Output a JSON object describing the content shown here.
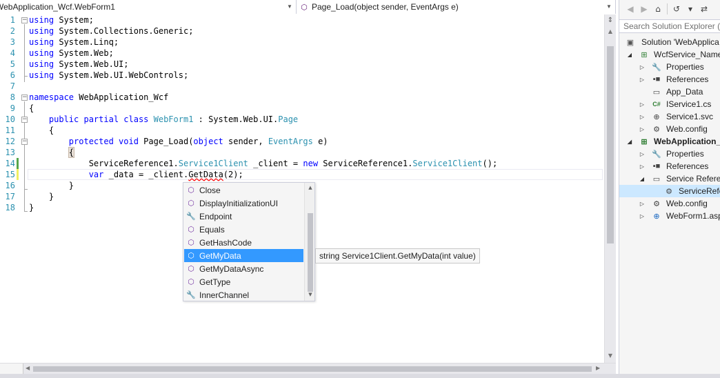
{
  "navbar": {
    "type_combo": "WebApplication_Wcf.WebForm1",
    "member_combo": "Page_Load(object sender, EventArgs e)"
  },
  "editor": {
    "line_numbers": [
      "1",
      "2",
      "3",
      "4",
      "5",
      "6",
      "7",
      "8",
      "9",
      "10",
      "11",
      "12",
      "13",
      "14",
      "15",
      "16",
      "17",
      "18"
    ],
    "lines": {
      "l1_kw": "using",
      "l1_rest": " System;",
      "l2_kw": "using",
      "l2_rest": " System.Collections.Generic;",
      "l3_kw": "using",
      "l3_rest": " System.Linq;",
      "l4_kw": "using",
      "l4_rest": " System.Web;",
      "l5_kw": "using",
      "l5_rest": " System.Web.UI;",
      "l6_kw": "using",
      "l6_rest": " System.Web.UI.WebControls;",
      "l8_kw": "namespace",
      "l8_rest": " WebApplication_Wcf",
      "l9": "{",
      "l10_kw": "    public partial class ",
      "l10_type": "WebForm1",
      "l10_mid": " : System.Web.UI.",
      "l10_type2": "Page",
      "l11": "    {",
      "l12_kw": "        protected void ",
      "l12_mid": "Page_Load(",
      "l12_kw2": "object",
      "l12_mid2": " sender, ",
      "l12_type": "EventArgs",
      "l12_end": " e)",
      "l13_indent": "        ",
      "l13_brace": "{",
      "l14_a": "            ServiceReference1.",
      "l14_type": "Service1Client",
      "l14_b": " _client = ",
      "l14_kw": "new",
      "l14_c": " ServiceReference1.",
      "l14_type2": "Service1Client",
      "l14_d": "();",
      "l15_indent": "            ",
      "l15_kw": "var",
      "l15_a": " _data = _client.",
      "l15_sq": "GetData",
      "l15_b": "(2);",
      "l16": "        }",
      "l17": "    }",
      "l18": "}"
    }
  },
  "completion": {
    "items": [
      {
        "label": "Close",
        "icon": "method-icon"
      },
      {
        "label": "DisplayInitializationUI",
        "icon": "method-icon"
      },
      {
        "label": "Endpoint",
        "icon": "property-icon"
      },
      {
        "label": "Equals",
        "icon": "method-icon"
      },
      {
        "label": "GetHashCode",
        "icon": "method-icon"
      },
      {
        "label": "GetMyData",
        "icon": "method-icon"
      },
      {
        "label": "GetMyDataAsync",
        "icon": "method-icon"
      },
      {
        "label": "GetType",
        "icon": "method-icon"
      },
      {
        "label": "InnerChannel",
        "icon": "property-icon"
      }
    ],
    "selected": "GetMyData",
    "tooltip": "string Service1Client.GetMyData(int value)"
  },
  "solution_explorer": {
    "search_placeholder": "Search Solution Explorer (C",
    "tree": [
      {
        "label": "Solution 'WebApplica",
        "icon": "solution-icon"
      },
      {
        "label": "WcfService_Name",
        "icon": "wcf-project-icon"
      },
      {
        "label": "Properties",
        "icon": "wrench-icon"
      },
      {
        "label": "References",
        "icon": "references-icon"
      },
      {
        "label": "App_Data",
        "icon": "folder-icon"
      },
      {
        "label": "IService1.cs",
        "icon": "csharp-file-icon"
      },
      {
        "label": "Service1.svc",
        "icon": "svc-file-icon"
      },
      {
        "label": "Web.config",
        "icon": "config-file-icon"
      },
      {
        "label": "WebApplication_V",
        "icon": "web-project-icon"
      },
      {
        "label": "Properties",
        "icon": "wrench-icon"
      },
      {
        "label": "References",
        "icon": "references-icon"
      },
      {
        "label": "Service Referen",
        "icon": "folder-icon"
      },
      {
        "label": "ServiceRefe",
        "icon": "service-reference-icon"
      },
      {
        "label": "Web.config",
        "icon": "config-file-icon"
      },
      {
        "label": "WebForm1.asp",
        "icon": "webform-icon"
      }
    ]
  }
}
